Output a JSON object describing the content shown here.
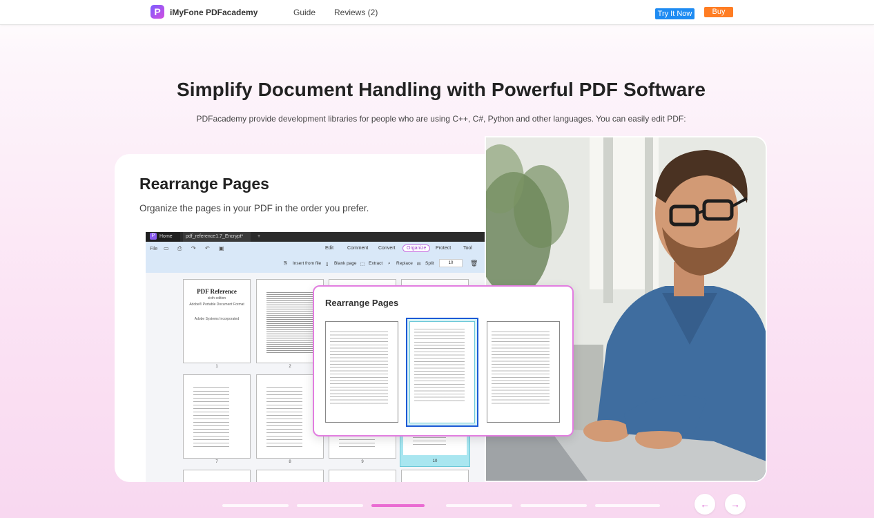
{
  "nav": {
    "logo_letter": "P",
    "brand": "iMyFone PDFacademy",
    "links": [
      "Guide",
      "Reviews (2)"
    ],
    "try_label": "Try It Now",
    "buy_label": "Buy"
  },
  "hero": {
    "title": "Simplify Document Handling with Powerful PDF Software",
    "subtitle": "PDFacademy provide development libraries for people who are using C++, C#, Python and other languages. You can easily edit PDF:"
  },
  "feature": {
    "title": "Rearrange Pages",
    "description": "Organize the pages in your PDF in the order you prefer."
  },
  "app": {
    "tabs": [
      "Home",
      "pdf_reference1.7_Encrypt*",
      "+"
    ],
    "file_menu": "File",
    "menu": [
      "Edit",
      "Comment",
      "Convert",
      "Organize",
      "Protect",
      "Tool"
    ],
    "active_menu": "Organize",
    "tools": [
      "Insert from file",
      "Blank page",
      "Extract",
      "Replace",
      "Split"
    ],
    "page_field": "10",
    "thumbs": {
      "first_title": "PDF Reference",
      "first_sub_1": "sixth edition",
      "first_sub_2": "Adobe® Portable Document Format",
      "first_sub_3": "Adobe Systems Incorporated",
      "labels": [
        "1",
        "2",
        "7",
        "8",
        "9",
        "10"
      ]
    }
  },
  "popup": {
    "title": "Rearrange Pages"
  },
  "carousel": {
    "count": 6,
    "active_index": 2
  },
  "arrows": {
    "prev": "←",
    "next": "→"
  },
  "colors": {
    "accent": "#ea6bd2",
    "try_button": "#1e8bf2",
    "buy_button": "#ff7d23"
  }
}
